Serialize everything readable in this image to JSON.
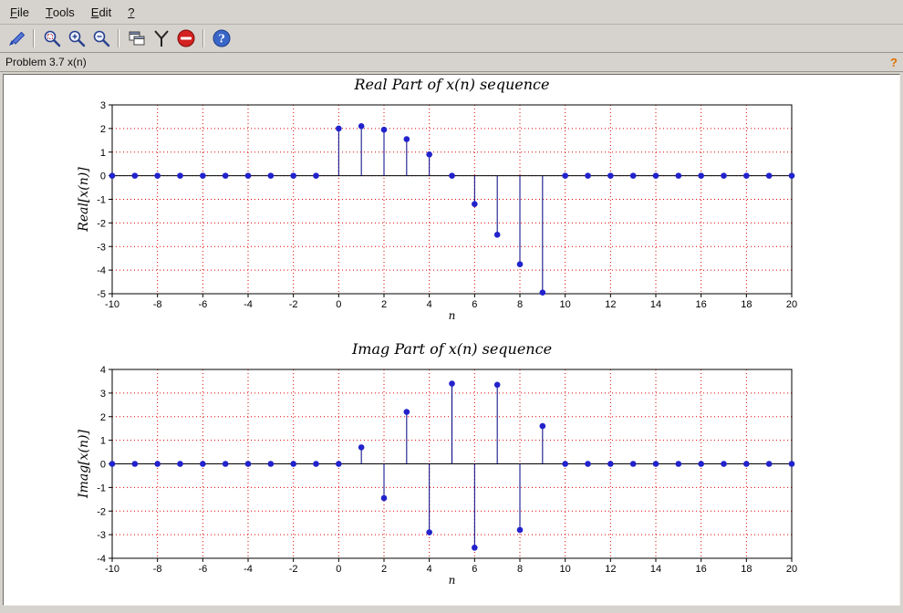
{
  "menu": {
    "items": [
      {
        "label": "File"
      },
      {
        "label": "Tools"
      },
      {
        "label": "Edit"
      },
      {
        "label": "?"
      }
    ]
  },
  "toolbar": {
    "icons": [
      {
        "name": "export-icon"
      },
      {
        "name": "zoom-area-icon"
      },
      {
        "name": "zoom-in-icon"
      },
      {
        "name": "zoom-out-icon"
      },
      {
        "name": "copy-figure-icon"
      },
      {
        "name": "rotate-axes-icon"
      },
      {
        "name": "stop-icon"
      },
      {
        "name": "help-icon"
      }
    ]
  },
  "infobar": {
    "title": "Problem 3.7 x(n)",
    "help_label": "?"
  },
  "chart_data": [
    {
      "type": "stem",
      "title": "Real Part of x(n) sequence",
      "xlabel": "n",
      "ylabel": "Real[x(n)]",
      "xlim": [
        -10,
        20
      ],
      "ylim": [
        -5,
        3
      ],
      "xticks": [
        -10,
        -8,
        -6,
        -4,
        -2,
        0,
        2,
        4,
        6,
        8,
        10,
        12,
        14,
        16,
        18,
        20
      ],
      "yticks": [
        -5,
        -4,
        -3,
        -2,
        -1,
        0,
        1,
        2,
        3
      ],
      "x": [
        -10,
        -9,
        -8,
        -7,
        -6,
        -5,
        -4,
        -3,
        -2,
        -1,
        0,
        1,
        2,
        3,
        4,
        5,
        6,
        7,
        8,
        9,
        10,
        11,
        12,
        13,
        14,
        15,
        16,
        17,
        18,
        19,
        20
      ],
      "values": [
        0,
        0,
        0,
        0,
        0,
        0,
        0,
        0,
        0,
        0,
        2,
        2.1,
        1.95,
        1.55,
        0.9,
        0,
        -1.2,
        -2.5,
        -3.75,
        -4.95,
        0,
        0,
        0,
        0,
        0,
        0,
        0,
        0,
        0,
        0,
        0
      ],
      "grid": true,
      "grid_color": "#e00000",
      "stem_color": "#000080",
      "marker_color": "#2222cc",
      "axis_color": "#000000"
    },
    {
      "type": "stem",
      "title": "Imag Part of x(n) sequence",
      "xlabel": "n",
      "ylabel": "Imag[x(n)]",
      "xlim": [
        -10,
        20
      ],
      "ylim": [
        -4,
        4
      ],
      "xticks": [
        -10,
        -8,
        -6,
        -4,
        -2,
        0,
        2,
        4,
        6,
        8,
        10,
        12,
        14,
        16,
        18,
        20
      ],
      "yticks": [
        -4,
        -3,
        -2,
        -1,
        0,
        1,
        2,
        3,
        4
      ],
      "x": [
        -10,
        -9,
        -8,
        -7,
        -6,
        -5,
        -4,
        -3,
        -2,
        -1,
        0,
        1,
        2,
        3,
        4,
        5,
        6,
        7,
        8,
        9,
        10,
        11,
        12,
        13,
        14,
        15,
        16,
        17,
        18,
        19,
        20
      ],
      "values": [
        0,
        0,
        0,
        0,
        0,
        0,
        0,
        0,
        0,
        0,
        0,
        0.7,
        -1.45,
        2.2,
        -2.9,
        3.4,
        -3.55,
        3.35,
        -2.8,
        1.6,
        0,
        0,
        0,
        0,
        0,
        0,
        0,
        0,
        0,
        0,
        0
      ],
      "grid": true,
      "grid_color": "#e00000",
      "stem_color": "#000080",
      "marker_color": "#2222cc",
      "axis_color": "#000000"
    }
  ]
}
